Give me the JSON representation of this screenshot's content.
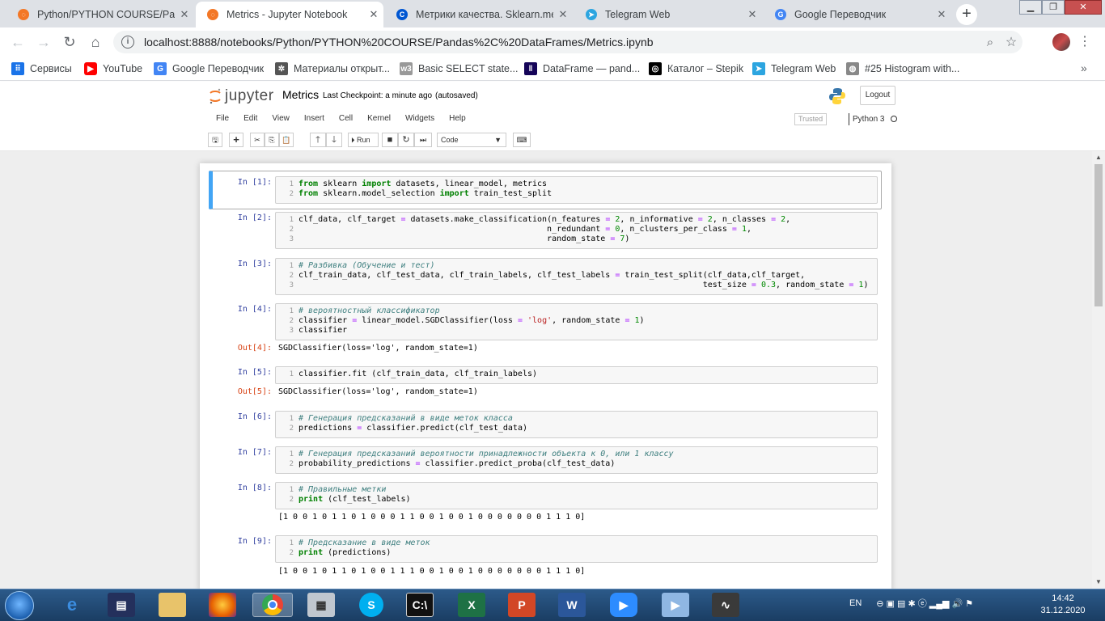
{
  "browser": {
    "tabs": [
      {
        "title": "Python/PYTHON COURSE/Panda",
        "favicon": "jupyter-icon"
      },
      {
        "title": "Metrics - Jupyter Notebook",
        "favicon": "jupyter-icon",
        "active": true
      },
      {
        "title": "Метрики качества. Sklearn.met",
        "favicon": "coursera-icon"
      },
      {
        "title": "Telegram Web",
        "favicon": "telegram-icon"
      },
      {
        "title": "Google Переводчик",
        "favicon": "google-translate-icon"
      }
    ],
    "close_glyph": "✕",
    "new_tab_glyph": "+",
    "url": "localhost:8888/notebooks/Python/PYTHON%20COURSE/Pandas%2C%20DataFrames/Metrics.ipynb",
    "bookmarks": [
      {
        "label": "Сервисы",
        "icon": "apps-grid-icon"
      },
      {
        "label": "YouTube",
        "icon": "youtube-icon"
      },
      {
        "label": "Google Переводчик",
        "icon": "google-translate-icon"
      },
      {
        "label": "Материалы открыт...",
        "icon": "gear-bookmark-icon"
      },
      {
        "label": "Basic SELECT state...",
        "icon": "w3r-icon"
      },
      {
        "label": "DataFrame — pand...",
        "icon": "pandas-icon"
      },
      {
        "label": "Каталог – Stepik",
        "icon": "stepik-icon"
      },
      {
        "label": "Telegram Web",
        "icon": "telegram-icon"
      },
      {
        "label": "#25 Histogram with...",
        "icon": "globe-icon"
      }
    ],
    "bookmarks_more": "»"
  },
  "jupyter": {
    "logo_text": "jupyter",
    "notebook_name": "Metrics",
    "checkpoint": "Last Checkpoint: a minute ago",
    "autosave": "(autosaved)",
    "logout_label": "Logout",
    "menu": [
      "File",
      "Edit",
      "View",
      "Insert",
      "Cell",
      "Kernel",
      "Widgets",
      "Help"
    ],
    "trusted_label": "Trusted",
    "kernel_name": "Python 3",
    "run_label": "Run",
    "cell_type": "Code"
  },
  "cells": [
    {
      "prompt": "In [1]:",
      "lines": [
        [
          [
            "kw",
            "from"
          ],
          [
            "n",
            " sklearn "
          ],
          [
            "kw",
            "import"
          ],
          [
            "n",
            " datasets, linear_model, metrics"
          ]
        ],
        [
          [
            "kw",
            "from"
          ],
          [
            "n",
            " sklearn.model_selection "
          ],
          [
            "kw",
            "import"
          ],
          [
            "n",
            " train_test_split"
          ]
        ]
      ]
    },
    {
      "prompt": "In [2]:",
      "lines": [
        [
          [
            "n",
            "clf_data, clf_target "
          ],
          [
            "op",
            "="
          ],
          [
            "n",
            " datasets.make_classification(n_features "
          ],
          [
            "op",
            "="
          ],
          [
            "n",
            " "
          ],
          [
            "nm",
            "2"
          ],
          [
            "n",
            ", n_informative "
          ],
          [
            "op",
            "="
          ],
          [
            "n",
            " "
          ],
          [
            "nm",
            "2"
          ],
          [
            "n",
            ", n_classes "
          ],
          [
            "op",
            "="
          ],
          [
            "n",
            " "
          ],
          [
            "nm",
            "2"
          ],
          [
            "n",
            ","
          ]
        ],
        [
          [
            "n",
            "                                                   n_redundant "
          ],
          [
            "op",
            "="
          ],
          [
            "n",
            " "
          ],
          [
            "nm",
            "0"
          ],
          [
            "n",
            ", n_clusters_per_class "
          ],
          [
            "op",
            "="
          ],
          [
            "n",
            " "
          ],
          [
            "nm",
            "1"
          ],
          [
            "n",
            ","
          ]
        ],
        [
          [
            "n",
            "                                                   random_state "
          ],
          [
            "op",
            "="
          ],
          [
            "n",
            " "
          ],
          [
            "nm",
            "7"
          ],
          [
            "n",
            ")"
          ]
        ]
      ]
    },
    {
      "prompt": "In [3]:",
      "lines": [
        [
          [
            "cm",
            "# Разбивка (Обучение и тест)"
          ]
        ],
        [
          [
            "n",
            "clf_train_data, clf_test_data, clf_train_labels, clf_test_labels "
          ],
          [
            "op",
            "="
          ],
          [
            "n",
            " train_test_split(clf_data,clf_target,"
          ]
        ],
        [
          [
            "n",
            "                                                                                   test_size "
          ],
          [
            "op",
            "="
          ],
          [
            "n",
            " "
          ],
          [
            "nm",
            "0.3"
          ],
          [
            "n",
            ", random_state "
          ],
          [
            "op",
            "="
          ],
          [
            "n",
            " "
          ],
          [
            "nm",
            "1"
          ],
          [
            "n",
            ")"
          ]
        ]
      ]
    },
    {
      "prompt": "In [4]:",
      "lines": [
        [
          [
            "cm",
            "# вероятностный классификатор"
          ]
        ],
        [
          [
            "n",
            "classifier "
          ],
          [
            "op",
            "="
          ],
          [
            "n",
            " linear_model.SGDClassifier(loss "
          ],
          [
            "op",
            "="
          ],
          [
            "n",
            " "
          ],
          [
            "st",
            "'log'"
          ],
          [
            "n",
            ", random_state "
          ],
          [
            "op",
            "="
          ],
          [
            "n",
            " "
          ],
          [
            "nm",
            "1"
          ],
          [
            "n",
            ")"
          ]
        ],
        [
          [
            "n",
            "classifier"
          ]
        ]
      ],
      "out_prompt": "Out[4]:",
      "output": "SGDClassifier(loss='log', random_state=1)"
    },
    {
      "prompt": "In [5]:",
      "lines": [
        [
          [
            "n",
            "classifier.fit (clf_train_data, clf_train_labels)"
          ]
        ]
      ],
      "out_prompt": "Out[5]:",
      "output": "SGDClassifier(loss='log', random_state=1)"
    },
    {
      "prompt": "In [6]:",
      "lines": [
        [
          [
            "cm",
            "# Генерация предсказаний в виде меток класса"
          ]
        ],
        [
          [
            "n",
            "predictions "
          ],
          [
            "op",
            "="
          ],
          [
            "n",
            " classifier.predict(clf_test_data)"
          ]
        ]
      ]
    },
    {
      "prompt": "In [7]:",
      "lines": [
        [
          [
            "cm",
            "# Генерация предсказаний вероятности принадлежности объекта к 0, или 1 классу"
          ]
        ],
        [
          [
            "n",
            "probability_predictions "
          ],
          [
            "op",
            "="
          ],
          [
            "n",
            " classifier.predict_proba(clf_test_data)"
          ]
        ]
      ]
    },
    {
      "prompt": "In [8]:",
      "lines": [
        [
          [
            "cm",
            "# Правильные метки"
          ]
        ],
        [
          [
            "kw",
            "print"
          ],
          [
            "n",
            " (clf_test_labels)"
          ]
        ]
      ],
      "output": "[1 0 0 1 0 1 1 0 1 0 0 0 1 1 0 0 1 0 0 1 0 0 0 0 0 0 0 1 1 1 0]"
    },
    {
      "prompt": "In [9]:",
      "lines": [
        [
          [
            "cm",
            "# Предсказание в виде меток"
          ]
        ],
        [
          [
            "kw",
            "print"
          ],
          [
            "n",
            " (predictions)"
          ]
        ]
      ],
      "output": "[1 0 0 1 0 1 1 0 1 0 0 1 1 1 0 0 1 0 0 1 0 0 0 0 0 0 0 1 1 1 0]"
    }
  ],
  "taskbar": {
    "lang": "EN",
    "time": "14:42",
    "date": "31.12.2020"
  }
}
